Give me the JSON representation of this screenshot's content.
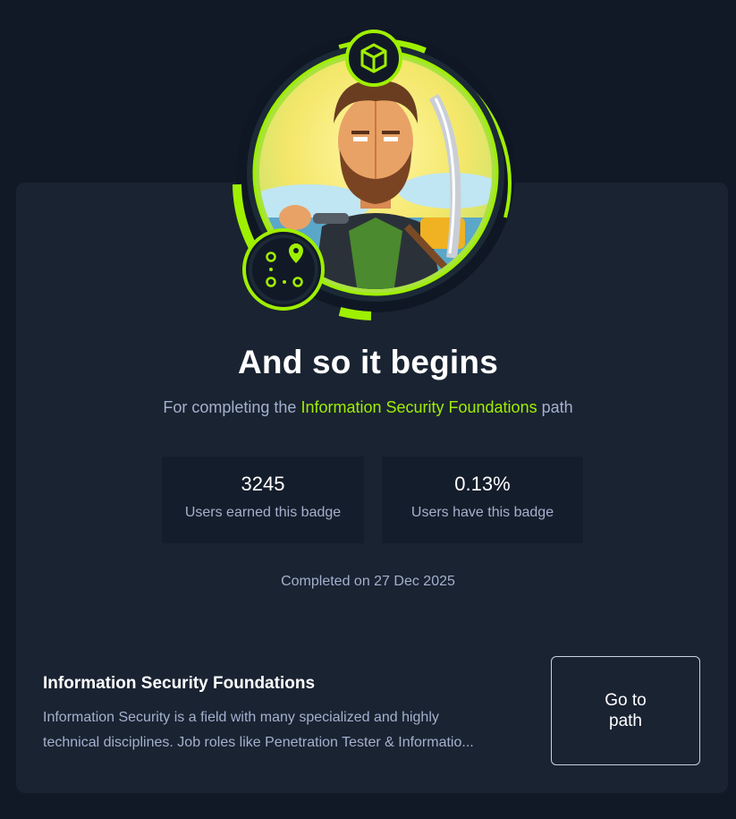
{
  "badge": {
    "name": "And so it begins",
    "description_prefix": "For completing the",
    "path_link": "Information Security Foundations",
    "description_suffix": "path",
    "icons": [
      "cube-icon",
      "path-map-icon"
    ],
    "accent_color": "#9fef00"
  },
  "stats": [
    {
      "value": "3245",
      "label": "Users earned this badge"
    },
    {
      "value": "0.13%",
      "label": "Users have this badge"
    }
  ],
  "completed": "Completed on 27 Dec 2025",
  "path": {
    "title": "Information Security Foundations",
    "description_line1": "Information Security is a field with many specialized and highly",
    "description_line2": "technical disciplines. Job roles like Penetration Tester & Informatio...",
    "button_line1": "Go to",
    "button_line2": "path"
  }
}
